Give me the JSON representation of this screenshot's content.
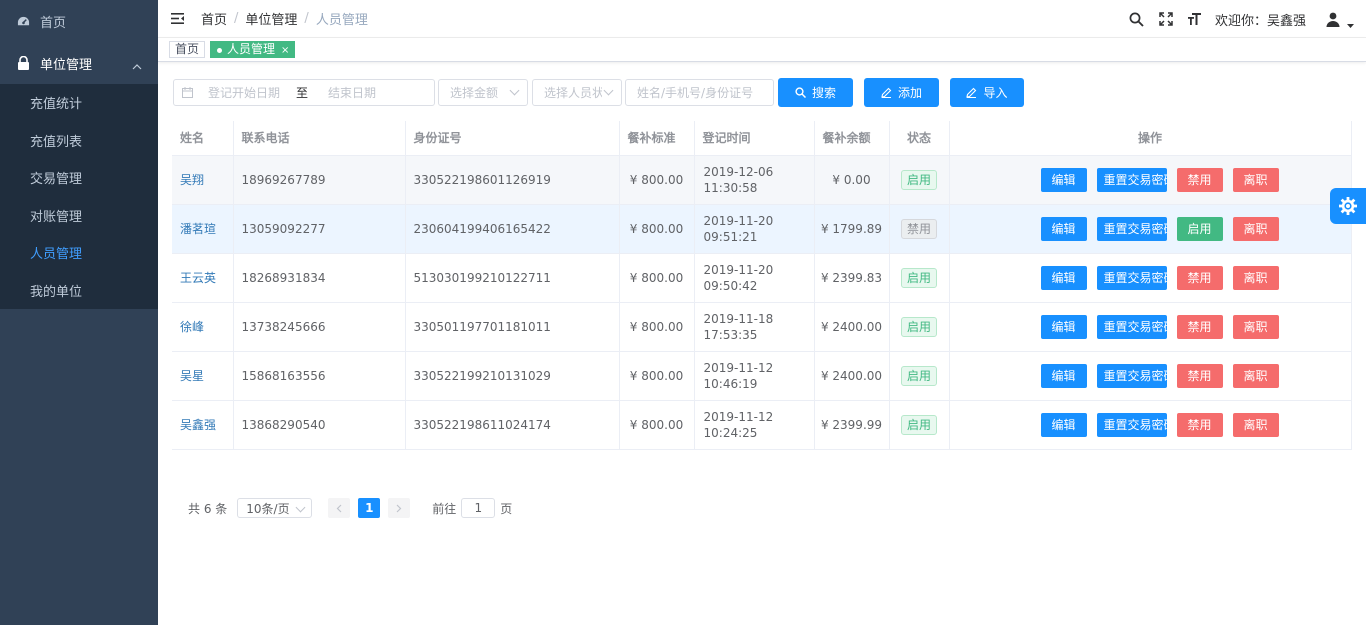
{
  "sidebar": {
    "home": "首页",
    "group": "单位管理",
    "items": [
      {
        "label": "充值统计"
      },
      {
        "label": "充值列表"
      },
      {
        "label": "交易管理"
      },
      {
        "label": "对账管理"
      },
      {
        "label": "人员管理"
      },
      {
        "label": "我的单位"
      }
    ]
  },
  "header": {
    "breadcrumb": [
      "首页",
      "单位管理",
      "人员管理"
    ],
    "separator": "/",
    "welcome": "欢迎你：吴鑫强"
  },
  "tags": {
    "home": "首页",
    "active": "人员管理",
    "close": "×"
  },
  "filters": {
    "start_date_placeholder": "登记开始日期",
    "range_sep": "至",
    "end_date_placeholder": "结束日期",
    "amount_placeholder": "选择金额",
    "status_placeholder": "选择人员状态",
    "keyword_placeholder": "姓名/手机号/身份证号",
    "search_label": "搜索",
    "add_label": "添加",
    "import_label": "导入"
  },
  "table": {
    "headers": [
      "姓名",
      "联系电话",
      "身份证号",
      "餐补标准",
      "登记时间",
      "餐补余额",
      "状态",
      "操作"
    ],
    "rows": [
      {
        "name": "吴翔",
        "phone": "18969267789",
        "id": "330522198601126919",
        "standard": "¥ 800.00",
        "time": "2019-12-06 11:30:58",
        "balance": "¥ 0.00",
        "status": "启用",
        "toggle": "禁用"
      },
      {
        "name": "潘茗瑄",
        "phone": "13059092277",
        "id": "230604199406165422",
        "standard": "¥ 800.00",
        "time": "2019-11-20 09:51:21",
        "balance": "¥ 1799.89",
        "status": "禁用",
        "toggle": "启用"
      },
      {
        "name": "王云英",
        "phone": "18268931834",
        "id": "513030199210122711",
        "standard": "¥ 800.00",
        "time": "2019-11-20 09:50:42",
        "balance": "¥ 2399.83",
        "status": "启用",
        "toggle": "禁用"
      },
      {
        "name": "徐峰",
        "phone": "13738245666",
        "id": "330501197701181011",
        "standard": "¥ 800.00",
        "time": "2019-11-18 17:53:35",
        "balance": "¥ 2400.00",
        "status": "启用",
        "toggle": "禁用"
      },
      {
        "name": "吴星",
        "phone": "15868163556",
        "id": "330522199210131029",
        "standard": "¥ 800.00",
        "time": "2019-11-12 10:46:19",
        "balance": "¥ 2400.00",
        "status": "启用",
        "toggle": "禁用"
      },
      {
        "name": "吴鑫强",
        "phone": "13868290540",
        "id": "330522198611024174",
        "standard": "¥ 800.00",
        "time": "2019-11-12 10:24:25",
        "balance": "¥ 2399.99",
        "status": "启用",
        "toggle": "禁用"
      }
    ],
    "op_labels": {
      "edit": "编辑",
      "reset": "重置交易密码",
      "quit": "离职"
    }
  },
  "pagination": {
    "total": "共 6 条",
    "page_size": "10条/页",
    "current": "1",
    "goto_label": "前往",
    "goto_value": "1",
    "page_unit": "页"
  },
  "colors": {
    "primary": "#1890ff",
    "success": "#42b983",
    "danger": "#f56c6c",
    "sidebar": "#304156"
  }
}
